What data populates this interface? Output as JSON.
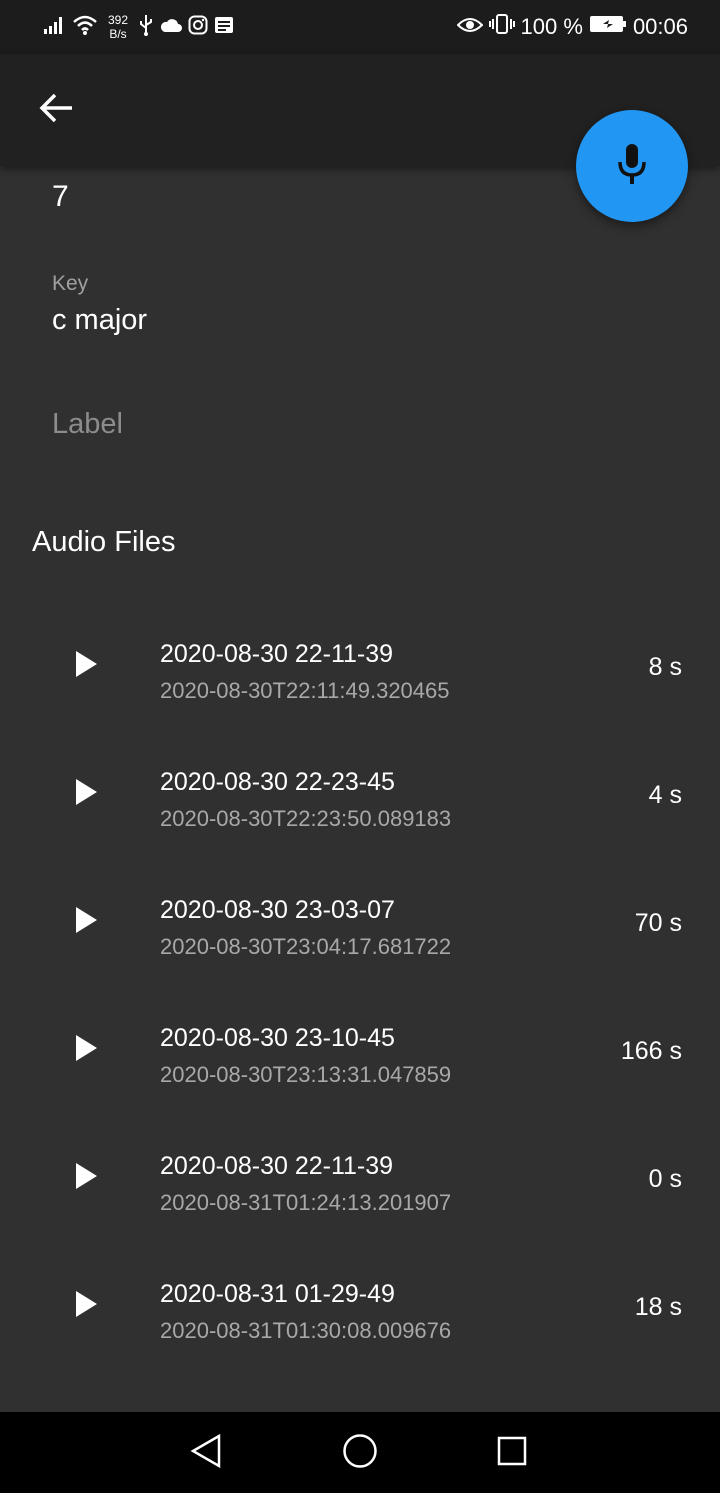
{
  "status_bar": {
    "net_speed_value": "392",
    "net_speed_unit": "B/s",
    "battery_percent": "100 %",
    "time": "00:06"
  },
  "form": {
    "cut_off_value": "7",
    "key_label": "Key",
    "key_value": "c major",
    "label_placeholder": "Label"
  },
  "section_title": "Audio Files",
  "audio_files": [
    {
      "title": "2020-08-30 22-11-39",
      "timestamp": "2020-08-30T22:11:49.320465",
      "duration": "8 s"
    },
    {
      "title": "2020-08-30 22-23-45",
      "timestamp": "2020-08-30T22:23:50.089183",
      "duration": "4 s"
    },
    {
      "title": "2020-08-30 23-03-07",
      "timestamp": "2020-08-30T23:04:17.681722",
      "duration": "70 s"
    },
    {
      "title": "2020-08-30 23-10-45",
      "timestamp": "2020-08-30T23:13:31.047859",
      "duration": "166 s"
    },
    {
      "title": "2020-08-30 22-11-39",
      "timestamp": "2020-08-31T01:24:13.201907",
      "duration": "0 s"
    },
    {
      "title": "2020-08-31 01-29-49",
      "timestamp": "2020-08-31T01:30:08.009676",
      "duration": "18 s"
    }
  ],
  "colors": {
    "fab": "#2196f3",
    "background": "#303030",
    "app_bar": "#212121"
  }
}
